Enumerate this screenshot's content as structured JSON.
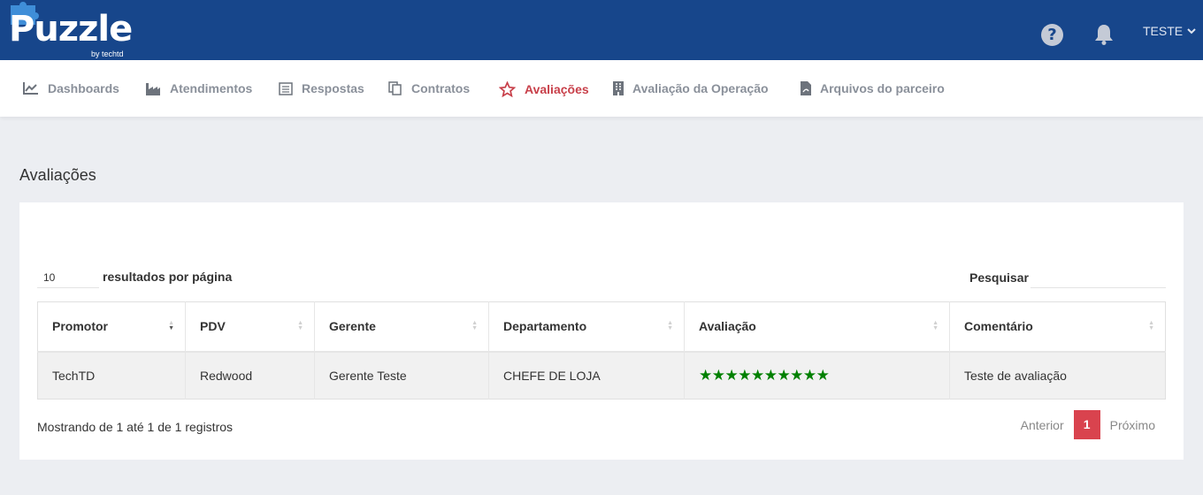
{
  "header": {
    "logo_text": "Puzzle",
    "logo_sub": "by techtd",
    "help_icon": "?",
    "user_name": "TESTE",
    "brand_color": "#17468b"
  },
  "nav": {
    "items": [
      {
        "label": "Dashboards",
        "icon": "line-chart-icon"
      },
      {
        "label": "Atendimentos",
        "icon": "industry-icon"
      },
      {
        "label": "Respostas",
        "icon": "list-alt-icon"
      },
      {
        "label": "Contratos",
        "icon": "copy-icon"
      },
      {
        "label": "Avaliações",
        "icon": "star-icon",
        "active": true
      },
      {
        "label": "Avaliação da Operação",
        "icon": "building-icon"
      },
      {
        "label": "Arquivos do parceiro",
        "icon": "file-pdf-icon"
      }
    ],
    "active_color": "#c8404a"
  },
  "page": {
    "title": "Avaliações"
  },
  "table_controls": {
    "page_length": "10",
    "length_label": "resultados por página",
    "search_label": "Pesquisar"
  },
  "table": {
    "columns": [
      "Promotor",
      "PDV",
      "Gerente",
      "Departamento",
      "Avaliação",
      "Comentário"
    ],
    "rows": [
      {
        "promotor": "TechTD",
        "pdv": "Redwood",
        "gerente": "Gerente Teste",
        "departamento": "CHEFE DE LOJA",
        "avaliacao_stars": 10,
        "comentario": "Teste de avaliação"
      }
    ],
    "star_color": "#008000"
  },
  "footer": {
    "info": "Mostrando de 1 até 1 de 1 registros",
    "prev": "Anterior",
    "page": "1",
    "next": "Próximo"
  }
}
